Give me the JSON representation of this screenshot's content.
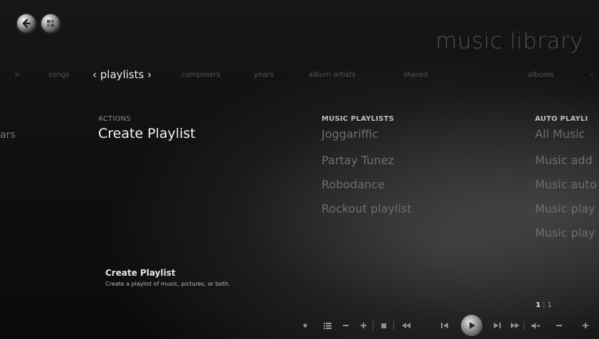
{
  "app": {
    "title": "music library"
  },
  "nav": {
    "back_icon": "back-arrow-icon",
    "home_icon": "windows-start-icon"
  },
  "categories": {
    "left_arrow": ">",
    "songs": "songs",
    "playlists": "‹ playlists ›",
    "composers": "composers",
    "years": "years",
    "album_artists": "album artists",
    "shared": "shared",
    "albums": "albums",
    "right_partial": "‹"
  },
  "columns": {
    "partial_left_item": "ars",
    "actions": {
      "header": "ACTIONS",
      "items": [
        "Create Playlist"
      ]
    },
    "music_playlists": {
      "header": "MUSIC PLAYLISTS",
      "items": [
        "Joggariffic",
        "Partay Tunez",
        "Robodance",
        "Rockout playlist"
      ]
    },
    "auto_playlists": {
      "header": "AUTO PLAYLI",
      "items": [
        "All Music",
        "Music add",
        "Music auto",
        "Music play",
        "Music play"
      ]
    }
  },
  "info": {
    "title": "Create Playlist",
    "description": "Create a playlist of music, pictures, or both."
  },
  "pagination": {
    "current": "1",
    "separator": "|",
    "total": "1"
  },
  "transport": {
    "record_icon": "record-dot-icon",
    "guide_icon": "guide-list-icon",
    "channel_down_icon": "minus-icon",
    "channel_up_icon": "plus-icon",
    "stop_icon": "stop-icon",
    "rewind_icon": "rewind-icon",
    "previous_icon": "skip-previous-icon",
    "play_icon": "play-icon",
    "next_icon": "skip-next-icon",
    "fast_forward_icon": "fast-forward-icon",
    "mute_icon": "speaker-mute-icon",
    "volume_down_icon": "volume-minus-icon",
    "volume_up_icon": "volume-plus-icon"
  },
  "colors": {
    "background": "#0b0b0b",
    "focused_text": "#f2f2f2",
    "dim_text": "#6e6e6e",
    "title_text": "#4d4d4d"
  }
}
